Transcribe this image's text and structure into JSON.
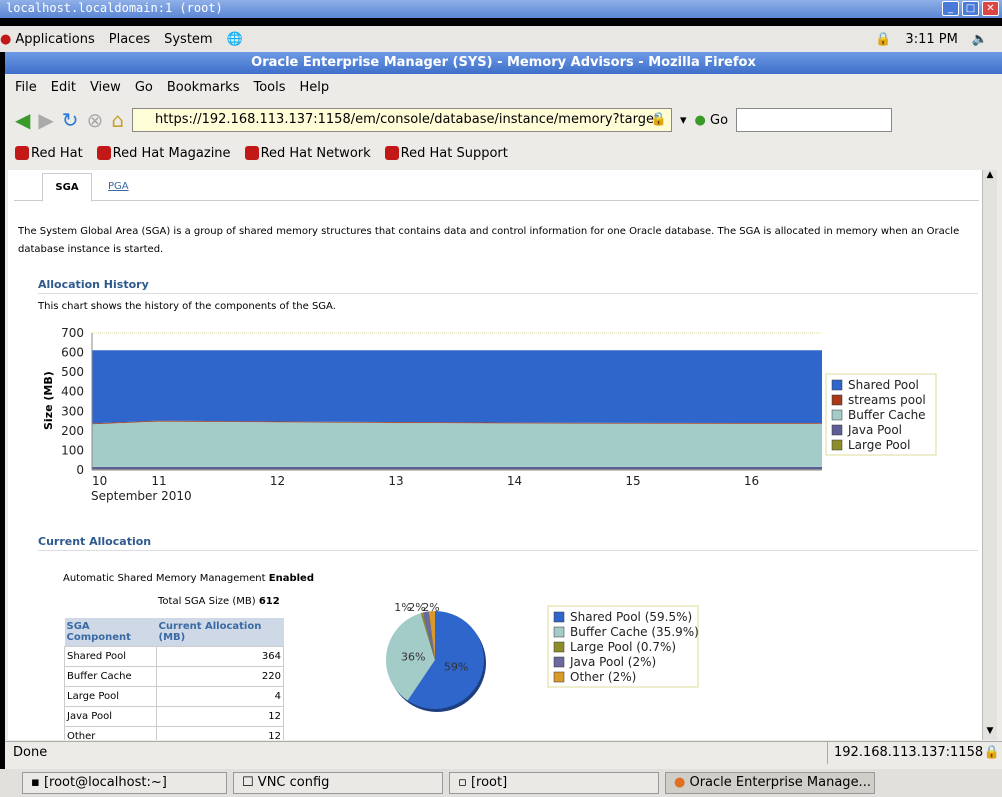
{
  "vnc": {
    "title": "localhost.localdomain:1 (root)"
  },
  "panel": {
    "applications": "Applications",
    "places": "Places",
    "system": "System",
    "clock": "3:11 PM"
  },
  "browser": {
    "title": "Oracle Enterprise Manager (SYS) - Memory Advisors - Mozilla Firefox",
    "menu": [
      "File",
      "Edit",
      "View",
      "Go",
      "Bookmarks",
      "Tools",
      "Help"
    ],
    "url": "https://192.168.113.137:1158/em/console/database/instance/memory?target",
    "go": "Go",
    "bookmarks": [
      "Red Hat",
      "Red Hat Magazine",
      "Red Hat Network",
      "Red Hat Support"
    ],
    "status": "Done",
    "status_host": "192.168.113.137:1158"
  },
  "page": {
    "tabs": [
      "SGA",
      "PGA"
    ],
    "intro": "The System Global Area (SGA) is a group of shared memory structures that contains data and control information for one Oracle database. The SGA is allocated in memory when an Oracle database instance is started.",
    "history_title": "Allocation History",
    "history_desc": "This chart shows the history of the components of the SGA.",
    "current_title": "Current Allocation",
    "asmm_label": "Automatic Shared Memory Management",
    "asmm_value": "Enabled",
    "total_label": "Total SGA Size (MB)",
    "total_value": "612",
    "table": {
      "headers": [
        "SGA Component",
        "Current Allocation (MB)"
      ],
      "rows": [
        [
          "Shared Pool",
          "364"
        ],
        [
          "Buffer Cache",
          "220"
        ],
        [
          "Large Pool",
          "4"
        ],
        [
          "Java Pool",
          "12"
        ],
        [
          "Other",
          "12"
        ]
      ]
    }
  },
  "chart_data": [
    {
      "type": "area",
      "stacked": true,
      "ylabel": "Size (MB)",
      "xlabel": "September 2010",
      "ylim": [
        0,
        700
      ],
      "yticks": [
        0,
        100,
        200,
        300,
        400,
        500,
        600,
        700
      ],
      "xticks": [
        "10",
        "11",
        "12",
        "13",
        "14",
        "15",
        "16"
      ],
      "x": [
        10.44,
        11,
        12,
        13,
        14,
        15,
        16,
        16.6
      ],
      "legend": "right",
      "series": [
        {
          "name": "Large Pool",
          "color": "#8c8c2a",
          "values": [
            4,
            4,
            4,
            4,
            4,
            4,
            4,
            4
          ]
        },
        {
          "name": "Java Pool",
          "color": "#5e5e96",
          "values": [
            12,
            12,
            12,
            12,
            12,
            12,
            12,
            12
          ]
        },
        {
          "name": "Buffer Cache",
          "color": "#a3cbc8",
          "values": [
            218,
            232,
            228,
            225,
            222,
            221,
            220,
            220
          ]
        },
        {
          "name": "streams pool",
          "color": "#a83a1a",
          "values": [
            4,
            4,
            4,
            4,
            4,
            4,
            4,
            4
          ]
        },
        {
          "name": "Shared Pool",
          "color": "#2f66cc",
          "values": [
            374,
            360,
            364,
            367,
            370,
            371,
            372,
            372
          ]
        }
      ],
      "legend_order": [
        "Shared Pool",
        "streams pool",
        "Buffer Cache",
        "Java Pool",
        "Large Pool"
      ]
    },
    {
      "type": "pie",
      "slices": [
        {
          "name": "Shared Pool (59.5%)",
          "value": 59.5,
          "label": "59%",
          "color": "#2f66cc"
        },
        {
          "name": "Buffer Cache (35.9%)",
          "value": 35.9,
          "label": "36%",
          "color": "#a3cbc8"
        },
        {
          "name": "Large Pool (0.7%)",
          "value": 0.7,
          "label": "1%",
          "color": "#8c8c2a"
        },
        {
          "name": "Java Pool (2%)",
          "value": 2,
          "label": "2%",
          "color": "#6a6a9e"
        },
        {
          "name": "Other (2%)",
          "value": 2,
          "label": "2%",
          "color": "#d99a2a"
        }
      ]
    }
  ],
  "taskbar": [
    "[root@localhost:~]",
    "VNC config",
    "[root]",
    "Oracle Enterprise Manage..."
  ]
}
